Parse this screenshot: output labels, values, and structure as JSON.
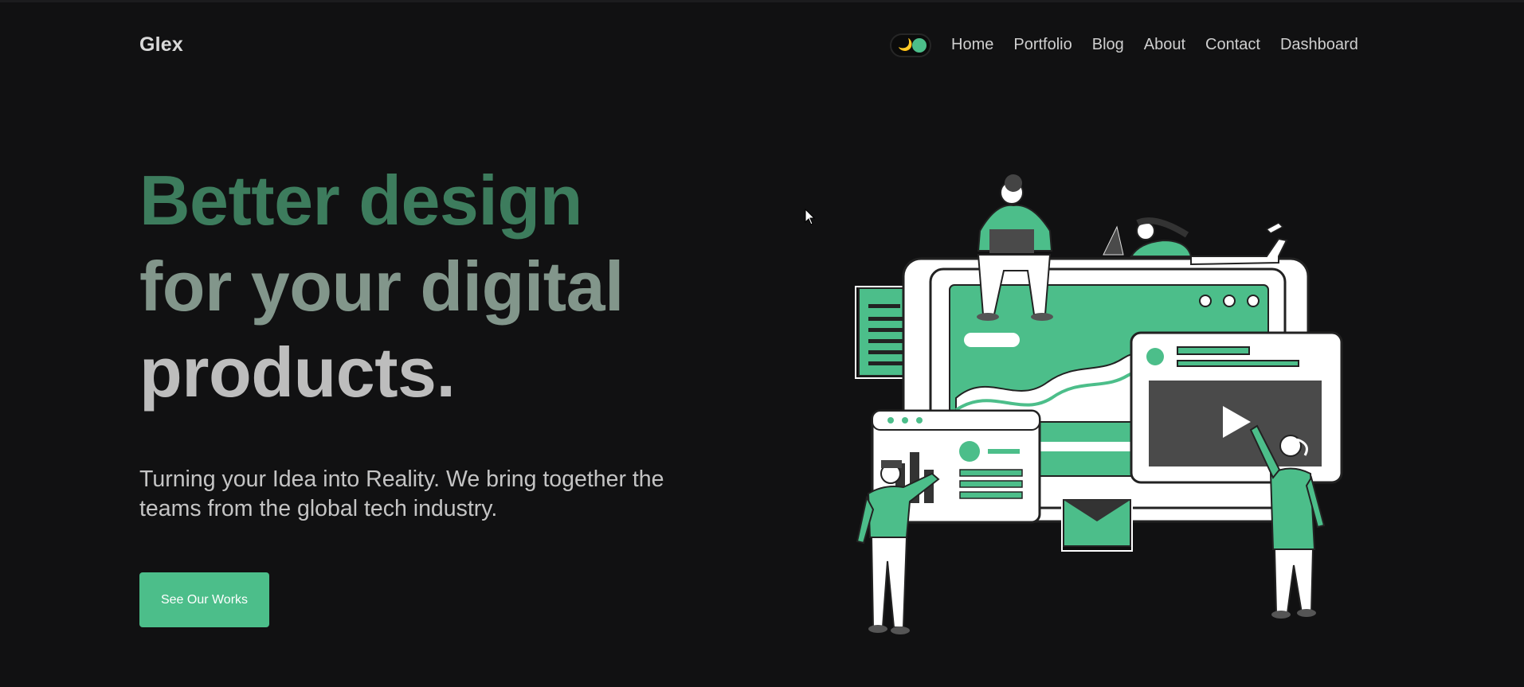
{
  "brand": {
    "logo_text": "Glex"
  },
  "theme_toggle": {
    "moon_icon": "🌙",
    "state": "dark"
  },
  "nav": {
    "items": [
      {
        "label": "Home"
      },
      {
        "label": "Portfolio"
      },
      {
        "label": "Blog"
      },
      {
        "label": "About"
      },
      {
        "label": "Contact"
      },
      {
        "label": "Dashboard"
      }
    ]
  },
  "hero": {
    "headline_line1": "Better design",
    "headline_line2": "for your digital",
    "headline_line3": "products.",
    "subtitle": "Turning your Idea into Reality. We bring together the teams from the global tech industry.",
    "cta_label": "See Our Works"
  },
  "colors": {
    "background": "#111112",
    "accent": "#4cbe8a",
    "headline_green": "#3d7c5d",
    "headline_mid": "#82968b",
    "headline_light": "#bdbdbd",
    "text": "#cfcfcf"
  },
  "icons": {
    "theme": "moon-icon",
    "video": "play-icon",
    "mail": "envelope-icon"
  }
}
